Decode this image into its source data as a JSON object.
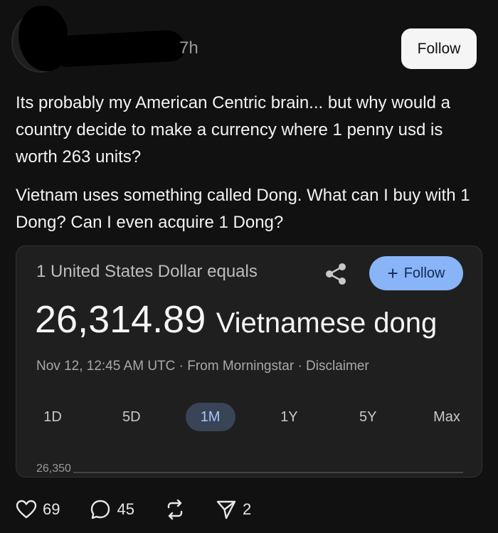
{
  "header": {
    "time_text": "7h",
    "follow_label": "Follow"
  },
  "post": {
    "paragraph_1": "Its probably my American Centric brain... but why would a country decide to make a currency where 1 penny usd is worth 263 units?",
    "paragraph_2": "Vietnam uses something called Dong. What can I buy with 1 Dong? Can I even acquire 1 Dong?"
  },
  "card": {
    "heading": "1 United States Dollar equals",
    "follow_label": "Follow",
    "rate_value": "26,314.89",
    "rate_unit": "Vietnamese dong",
    "meta": "Nov 12, 12:45 AM UTC · From Morningstar · Disclaimer",
    "tabs": [
      {
        "label": "1D"
      },
      {
        "label": "5D"
      },
      {
        "label": "1M"
      },
      {
        "label": "1Y"
      },
      {
        "label": "5Y"
      },
      {
        "label": "Max"
      }
    ],
    "active_tab": "1M",
    "chart_axis_label": "26,350",
    "accent_color": "#8ab4f8"
  },
  "footer": {
    "likes": "69",
    "comments": "45",
    "shares": "2",
    "icons": [
      "heart-icon",
      "comment-icon",
      "repost-icon",
      "send-icon"
    ]
  }
}
